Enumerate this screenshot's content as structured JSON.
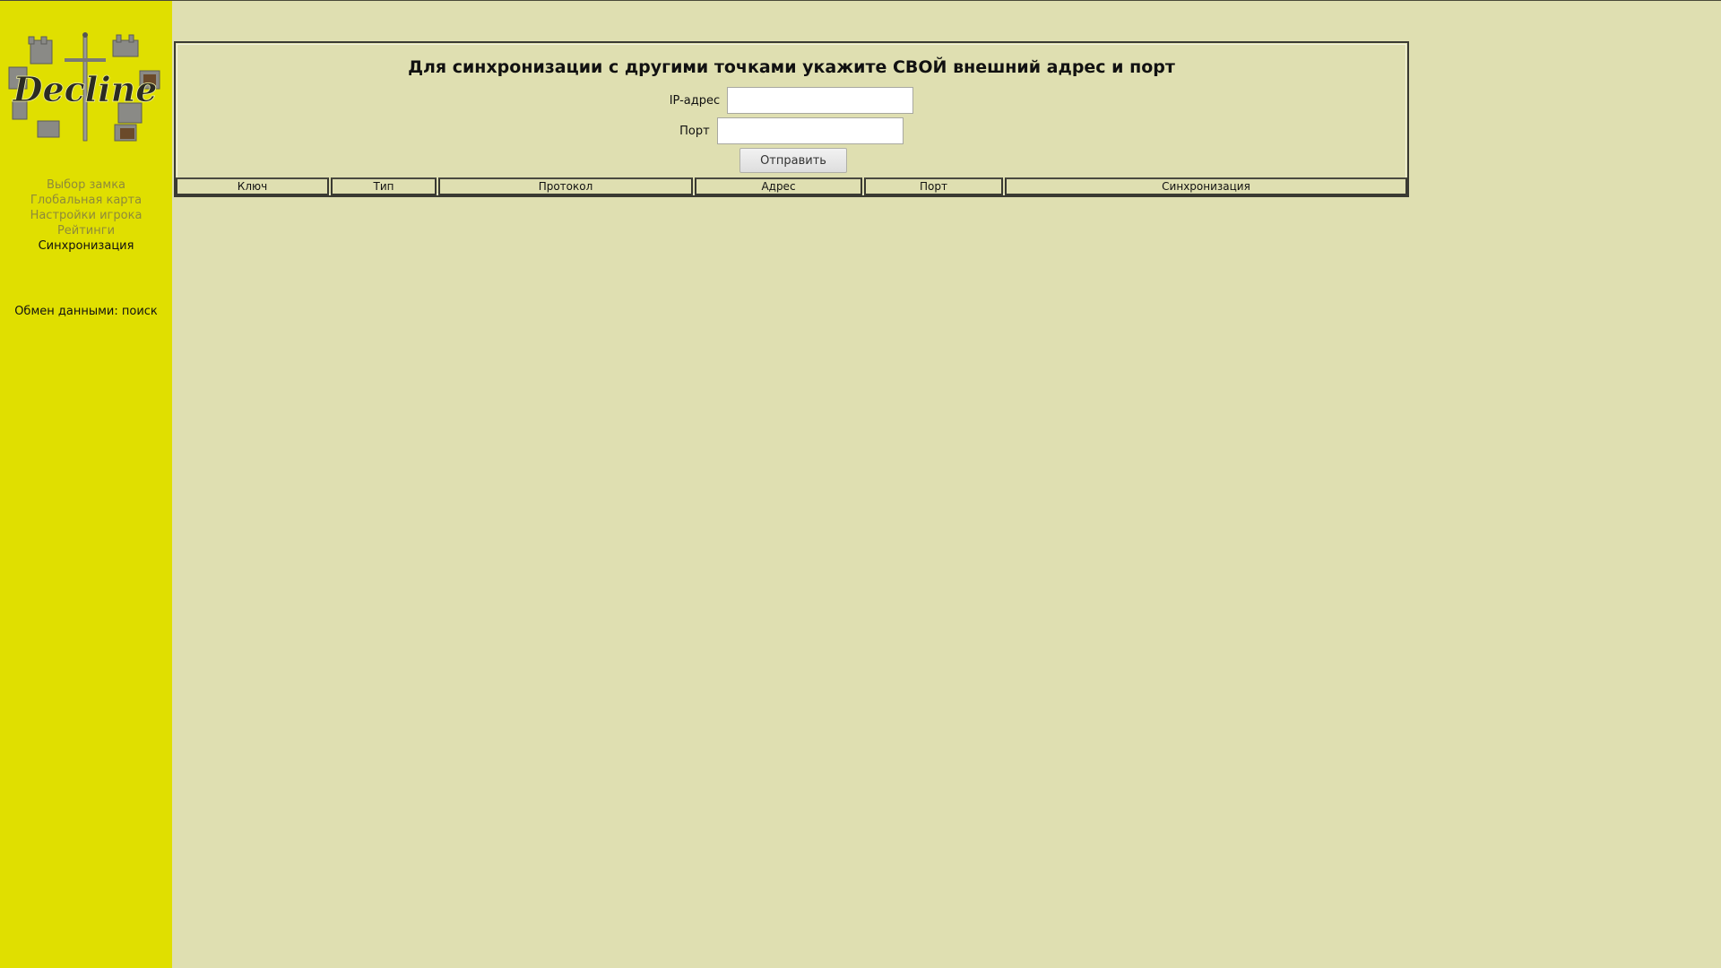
{
  "sidebar": {
    "logo_text": "Decline",
    "nav_items": [
      {
        "label": "Выбор замка",
        "active": false
      },
      {
        "label": "Глобальная карта",
        "active": false
      },
      {
        "label": "Настройки игрока",
        "active": false
      },
      {
        "label": "Рейтинги",
        "active": false
      },
      {
        "label": "Синхронизация",
        "active": true
      }
    ],
    "exchange_status": "Обмен данными: поиск"
  },
  "main": {
    "title": "Для синхронизации с другими точками укажите СВОЙ внешний адрес и порт",
    "form": {
      "ip_label": "IP-адрес",
      "ip_value": "",
      "port_label": "Порт",
      "port_value": "",
      "submit_label": "Отправить"
    },
    "table": {
      "headers": [
        "Ключ",
        "Тип",
        "Протокол",
        "Адрес",
        "Порт",
        "Синхронизация"
      ]
    }
  },
  "colors": {
    "sidebar_bg": "#e0df00",
    "page_bg": "#dfdfb1",
    "nav_inactive": "#8e8a3a",
    "nav_active": "#111111"
  }
}
